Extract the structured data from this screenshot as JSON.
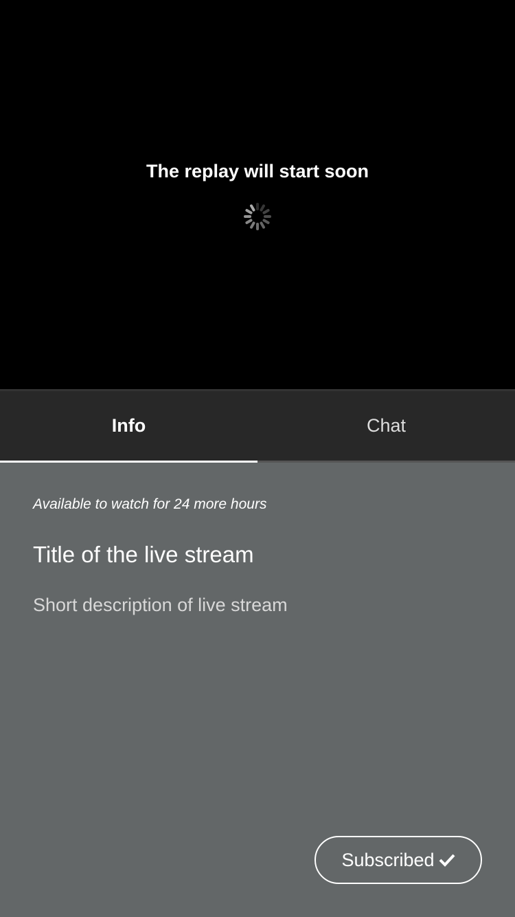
{
  "player": {
    "message": "The replay will start soon"
  },
  "tabs": [
    {
      "label": "Info",
      "active": true
    },
    {
      "label": "Chat",
      "active": false
    }
  ],
  "info": {
    "availability": "Available to watch for 24 more hours",
    "title": "Title of the live stream",
    "description": "Short description of live stream"
  },
  "subscribe": {
    "label": "Subscribed",
    "icon": "checkmark-icon"
  }
}
